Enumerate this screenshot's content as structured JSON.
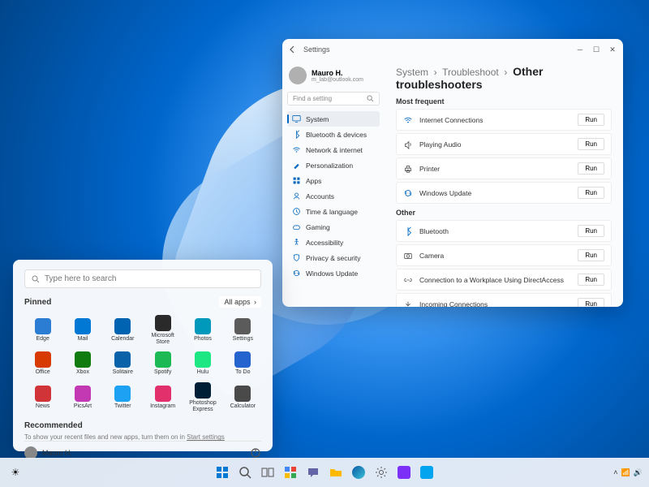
{
  "taskbar": {
    "center_icons": [
      "start",
      "search",
      "task-view",
      "widgets",
      "chat",
      "file-explorer",
      "edge",
      "store",
      "mail",
      "photos"
    ],
    "right_text": ""
  },
  "start_menu": {
    "search_placeholder": "Type here to search",
    "pinned_label": "Pinned",
    "all_apps_label": "All apps",
    "recommended_label": "Recommended",
    "recommended_hint_prefix": "To show your recent files and new apps, turn them on in ",
    "recommended_hint_link": "Start settings",
    "user_name": "Mauro H.",
    "apps": [
      {
        "label": "Edge",
        "color": "#2b7cd3"
      },
      {
        "label": "Mail",
        "color": "#0078d4"
      },
      {
        "label": "Calendar",
        "color": "#0063b1"
      },
      {
        "label": "Microsoft Store",
        "color": "#2a2a2a"
      },
      {
        "label": "Photos",
        "color": "#0099bc"
      },
      {
        "label": "Settings",
        "color": "#5b5b5b"
      },
      {
        "label": "Office",
        "color": "#d83b01"
      },
      {
        "label": "Xbox",
        "color": "#107c10"
      },
      {
        "label": "Solitaire",
        "color": "#0a63a8"
      },
      {
        "label": "Spotify",
        "color": "#1db954"
      },
      {
        "label": "Hulu",
        "color": "#1ce783"
      },
      {
        "label": "To Do",
        "color": "#2564cf"
      },
      {
        "label": "News",
        "color": "#d13438"
      },
      {
        "label": "PicsArt",
        "color": "#c239b3"
      },
      {
        "label": "Twitter",
        "color": "#1da1f2"
      },
      {
        "label": "Instagram",
        "color": "#e1306c"
      },
      {
        "label": "Photoshop Express",
        "color": "#001e36"
      },
      {
        "label": "Calculator",
        "color": "#4a4a4a"
      }
    ]
  },
  "settings": {
    "title": "Settings",
    "user": {
      "name": "Mauro H.",
      "email": "m_lab@outlook.com"
    },
    "search_placeholder": "Find a setting",
    "nav": [
      {
        "label": "System",
        "icon": "display",
        "active": true
      },
      {
        "label": "Bluetooth & devices",
        "icon": "bluetooth"
      },
      {
        "label": "Network & internet",
        "icon": "wifi"
      },
      {
        "label": "Personalization",
        "icon": "brush"
      },
      {
        "label": "Apps",
        "icon": "apps"
      },
      {
        "label": "Accounts",
        "icon": "person"
      },
      {
        "label": "Time & language",
        "icon": "clock"
      },
      {
        "label": "Gaming",
        "icon": "game"
      },
      {
        "label": "Accessibility",
        "icon": "access"
      },
      {
        "label": "Privacy & security",
        "icon": "shield"
      },
      {
        "label": "Windows Update",
        "icon": "update"
      }
    ],
    "breadcrumb": [
      "System",
      "Troubleshoot",
      "Other troubleshooters"
    ],
    "sections": [
      {
        "title": "Most frequent",
        "items": [
          {
            "label": "Internet Connections",
            "icon": "wifi",
            "action": "Run"
          },
          {
            "label": "Playing Audio",
            "icon": "audio",
            "action": "Run"
          },
          {
            "label": "Printer",
            "icon": "printer",
            "action": "Run"
          },
          {
            "label": "Windows Update",
            "icon": "update",
            "action": "Run"
          }
        ]
      },
      {
        "title": "Other",
        "items": [
          {
            "label": "Bluetooth",
            "icon": "bluetooth",
            "action": "Run"
          },
          {
            "label": "Camera",
            "icon": "camera",
            "action": "Run"
          },
          {
            "label": "Connection to a Workplace Using DirectAccess",
            "icon": "link",
            "action": "Run"
          },
          {
            "label": "Incoming Connections",
            "icon": "incoming",
            "action": "Run"
          }
        ]
      }
    ]
  }
}
